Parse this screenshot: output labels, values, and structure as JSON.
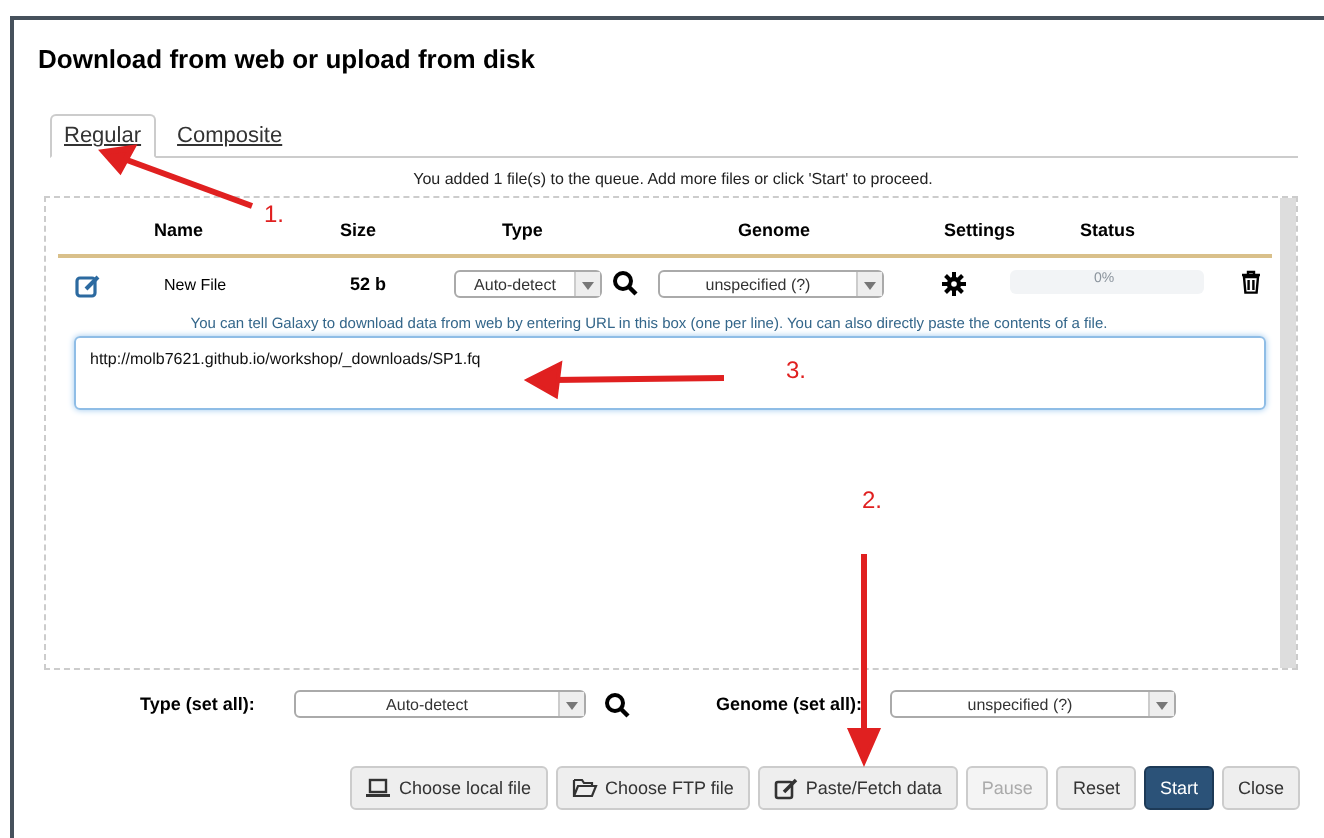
{
  "dialog": {
    "title": "Download from web or upload from disk"
  },
  "tabs": [
    {
      "label": "Regular",
      "selected": true
    },
    {
      "label": "Composite",
      "selected": false
    }
  ],
  "queue_message": "You added 1 file(s) to the queue. Add more files or click 'Start' to proceed.",
  "table": {
    "columns": [
      "Name",
      "Size",
      "Type",
      "Genome",
      "Settings",
      "Status"
    ],
    "rows": [
      {
        "name": "New File",
        "size": "52 b",
        "type": "Auto-detect",
        "genome": "unspecified (?)",
        "status": {
          "level": 0,
          "reading": "0%"
        },
        "hint": "You can tell Galaxy to download data from web by entering URL in this box (one per line). You can also directly paste the contents of a file.",
        "url": "http://molb7621.github.io/workshop/_downloads/SP1.fq"
      }
    ]
  },
  "set_all": {
    "type_label": "Type (set all):",
    "type_value": "Auto-detect",
    "genome_label": "Genome (set all):",
    "genome_value": "unspecified (?)"
  },
  "buttons": [
    {
      "label": "Choose local file",
      "kind": "laptop",
      "disabled": false,
      "primary": false
    },
    {
      "label": "Choose FTP file",
      "kind": "folder",
      "disabled": false,
      "primary": false
    },
    {
      "label": "Paste/Fetch data",
      "kind": "edit",
      "disabled": false,
      "primary": false
    },
    {
      "label": "Pause",
      "kind": "plain",
      "disabled": true,
      "primary": false
    },
    {
      "label": "Reset",
      "kind": "plain",
      "disabled": false,
      "primary": false
    },
    {
      "label": "Start",
      "kind": "plain",
      "disabled": false,
      "primary": true
    },
    {
      "label": "Close",
      "kind": "plain",
      "disabled": false,
      "primary": false
    }
  ],
  "annotations": [
    {
      "label": "1."
    },
    {
      "label": "2."
    },
    {
      "label": "3."
    }
  ]
}
